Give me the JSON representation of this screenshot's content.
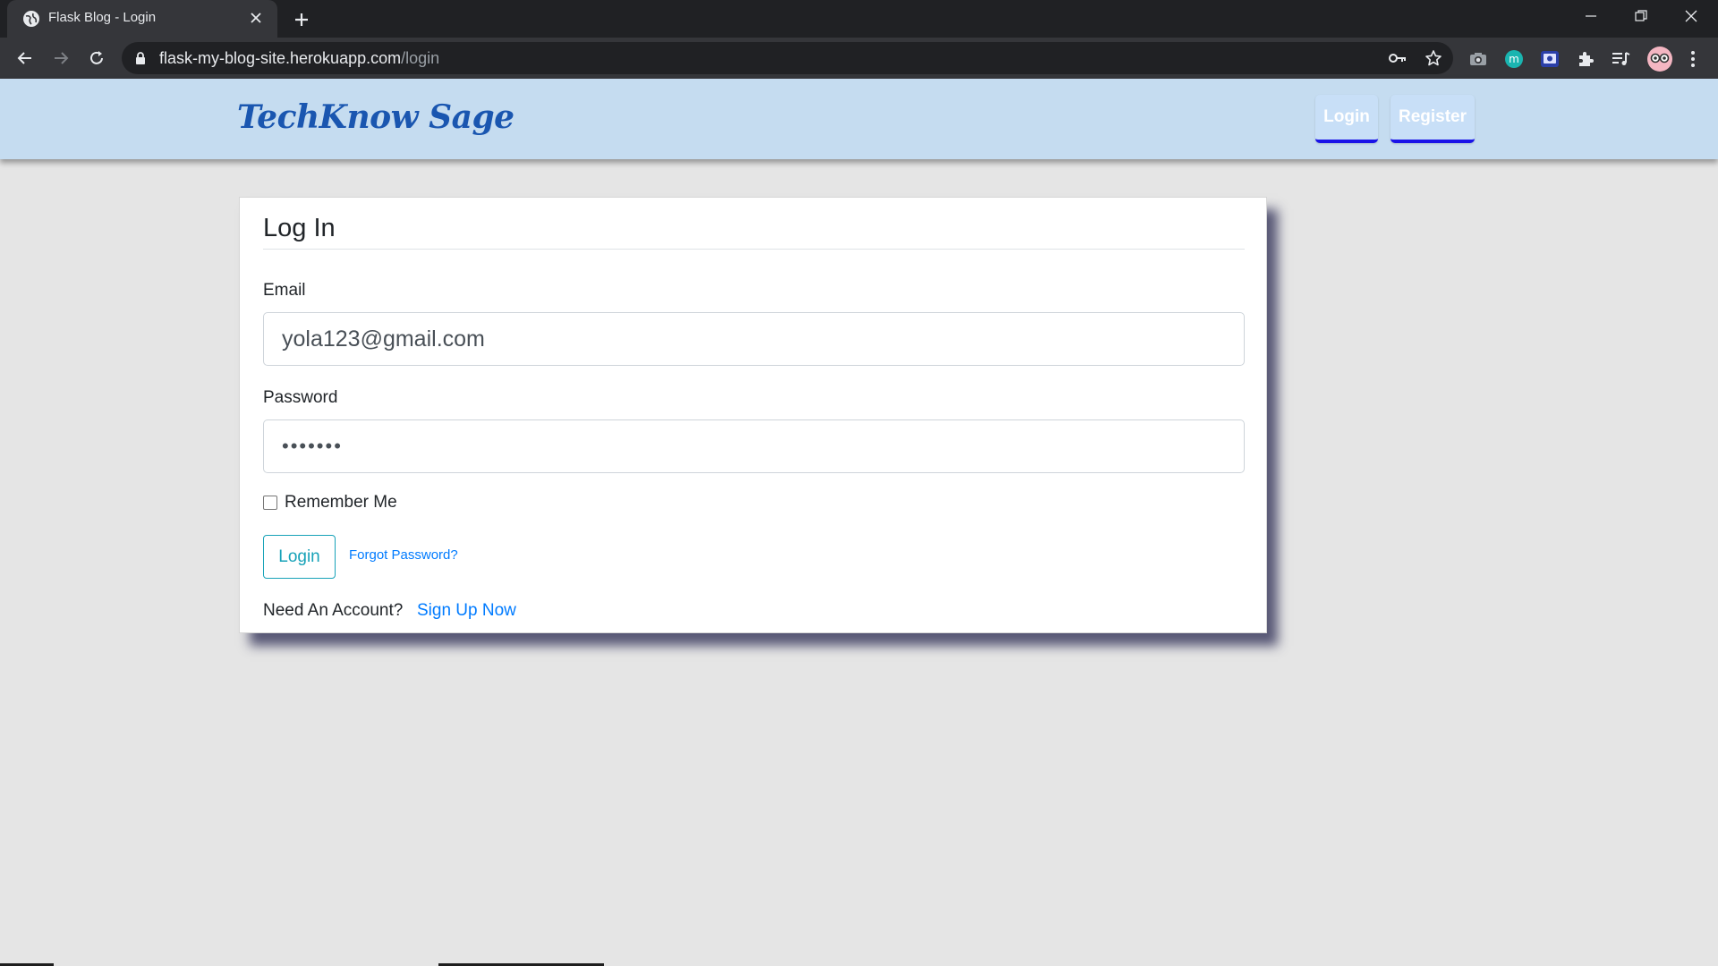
{
  "browser": {
    "tab_title": "Flask Blog - Login",
    "url_host": "flask-my-blog-site.herokuapp.com",
    "url_path": "/login",
    "icons": [
      "globe-icon",
      "close-icon",
      "plus-icon",
      "minimize-icon",
      "restore-icon",
      "window-close-icon",
      "back-arrow-icon",
      "forward-arrow-icon",
      "reload-icon",
      "lock-icon",
      "key-icon",
      "star-icon",
      "camera-icon",
      "m-extension-icon",
      "screen-extension-icon",
      "puzzle-icon",
      "media-queue-icon",
      "profile-avatar-icon",
      "kebab-menu-icon"
    ]
  },
  "header": {
    "brand": "TechKnow Sage",
    "login_label": "Login",
    "register_label": "Register"
  },
  "form": {
    "title": "Log In",
    "email_label": "Email",
    "email_value": "yola123@gmail.com",
    "password_label": "Password",
    "password_value": "•••••••",
    "remember_label": "Remember Me",
    "submit_label": "Login",
    "forgot_label": "Forgot Password?",
    "need_account": "Need An Account?",
    "signup_label": "Sign Up Now"
  },
  "colors": {
    "header_bg": "#c5dcf0",
    "brand": "#1a56b0",
    "header_btn_underline": "#1a13e8",
    "outline_info": "#17a2b8",
    "link": "#007bff",
    "page_bg": "#e5e5e5"
  }
}
